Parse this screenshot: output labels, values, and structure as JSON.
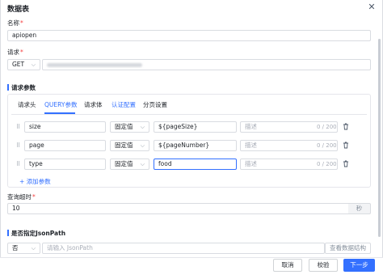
{
  "dialog": {
    "title": "数据表",
    "close_icon": "close-icon"
  },
  "name_field": {
    "label": "名称",
    "required_mark": "*",
    "value": "apiopen"
  },
  "request_field": {
    "label": "请求",
    "required_mark": "*",
    "method": "GET"
  },
  "request_params": {
    "section_title": "请求参数",
    "tabs": [
      {
        "label": "请求头",
        "active": false
      },
      {
        "label": "QUERY参数",
        "active": true
      },
      {
        "label": "请求体",
        "active": false
      },
      {
        "label": "认证配置",
        "active": false,
        "highlight": true
      },
      {
        "label": "分页设置",
        "active": false
      }
    ],
    "rows": [
      {
        "key": "size",
        "value_type": "固定值",
        "value": "${pageSize}",
        "desc_placeholder": "描述",
        "counter": "0 / 200"
      },
      {
        "key": "page",
        "value_type": "固定值",
        "value": "${pageNumber}",
        "desc_placeholder": "描述",
        "counter": "0 / 200"
      },
      {
        "key": "type",
        "value_type": "固定值",
        "value": "food",
        "desc_placeholder": "描述",
        "counter": "0 / 200"
      }
    ],
    "add_label": "添加参数"
  },
  "timeout_field": {
    "label": "查询超时",
    "required_mark": "*",
    "value": "10",
    "unit": "秒"
  },
  "jsonpath_section": {
    "title": "是否指定JsonPath",
    "select_value": "否",
    "input_placeholder": "请输入 JsonPath",
    "link_label": "查看数据结构"
  },
  "footer": {
    "cancel_label": "取消",
    "validate_label": "校验",
    "next_label": "下一步"
  },
  "colors": {
    "primary": "#3370ff",
    "required": "#f53f3f",
    "border": "#d9dce1"
  }
}
